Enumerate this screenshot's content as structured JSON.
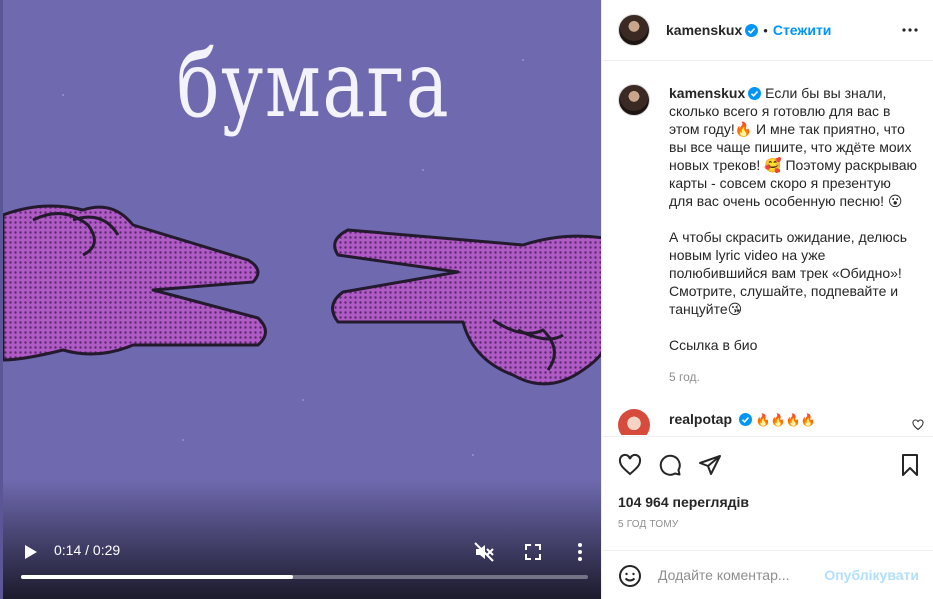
{
  "video": {
    "title_text": "бумага",
    "time": "0:14 / 0:29",
    "progress_fraction": 0.48,
    "icons": [
      "play-icon",
      "mute-icon",
      "fullscreen-icon",
      "more-vertical-icon"
    ]
  },
  "header": {
    "username": "kamenskux",
    "separator": "•",
    "follow_label": "Стежити"
  },
  "caption": {
    "username": "kamenskux",
    "text": "Если бы вы знали, сколько всего я готовлю для вас в этом году!🔥 И мне так приятно, что вы все чаще пишите, что ждёте моих новых треков! 🥰 Поэтому раскрываю карты - совсем скоро я презентую для вас очень особенную песню! 😮\n\nА чтобы скрасить ожидание, делюсь новым lyric video на уже полюбившийся вам трек «Обидно»! Смотрите, слушайте, подпевайте и танцуйте😘\n\nСсылка в био",
    "age": "5 год."
  },
  "comment": {
    "username": "realpotap",
    "text": "🔥🔥🔥🔥"
  },
  "stats": {
    "views": "104 964 переглядів",
    "posted": "5 ГОД ТОМУ"
  },
  "add_comment": {
    "placeholder": "Додайте коментар...",
    "publish_label": "Опублікувати"
  },
  "colors": {
    "accent": "#0095f6",
    "publish_disabled": "#b2dffc",
    "video_bg": "#6f6ab0",
    "hand_fill": "#b35cc8"
  }
}
